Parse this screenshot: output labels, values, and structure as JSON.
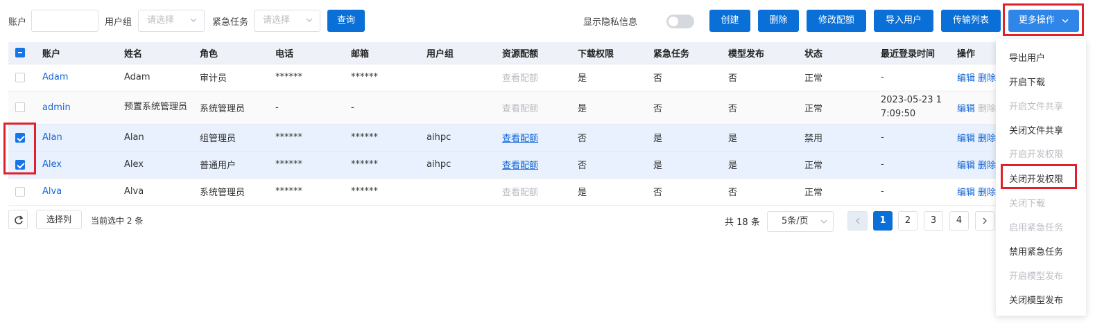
{
  "filters": {
    "account_label": "账户",
    "account_value": "",
    "group_label": "用户组",
    "group_placeholder": "请选择",
    "urgent_label": "紧急任务",
    "urgent_placeholder": "请选择",
    "query_button": "查询"
  },
  "privacy": {
    "label": "显示隐私信息",
    "enabled": false
  },
  "actions": {
    "create": "创建",
    "delete": "删除",
    "edit_quota": "修改配额",
    "import_users": "导入用户",
    "transfer_list": "传输列表",
    "more_actions": "更多操作"
  },
  "table": {
    "headers": [
      "账户",
      "姓名",
      "角色",
      "电话",
      "邮箱",
      "用户组",
      "资源配额",
      "下载权限",
      "紧急任务",
      "模型发布",
      "状态",
      "最近登录时间",
      "操作"
    ],
    "rows": [
      {
        "checked": false,
        "account": "Adam",
        "name": "Adam",
        "role": "审计员",
        "phone": "******",
        "email": "******",
        "group": "",
        "quota": "查看配额",
        "quota_enabled": false,
        "download": "是",
        "urgent": "否",
        "publish": "否",
        "status": "正常",
        "last_login": "-",
        "edit": "编辑",
        "del": "删除"
      },
      {
        "checked": false,
        "account": "admin",
        "name": "预置系统管理员",
        "role": "系统管理员",
        "phone": "-",
        "email": "-",
        "group": "",
        "quota": "查看配额",
        "quota_enabled": false,
        "download": "是",
        "urgent": "否",
        "publish": "否",
        "status": "正常",
        "last_login": "2023-05-23 17:09:50",
        "edit": "编辑",
        "del": "删除"
      },
      {
        "checked": true,
        "account": "Alan",
        "name": "Alan",
        "role": "组管理员",
        "phone": "******",
        "email": "******",
        "group": "aihpc",
        "quota": "查看配额",
        "quota_enabled": true,
        "download": "否",
        "urgent": "是",
        "publish": "是",
        "status": "禁用",
        "last_login": "-",
        "edit": "编辑",
        "del": "删除"
      },
      {
        "checked": true,
        "account": "Alex",
        "name": "Alex",
        "role": "普通用户",
        "phone": "******",
        "email": "******",
        "group": "aihpc",
        "quota": "查看配额",
        "quota_enabled": true,
        "download": "否",
        "urgent": "是",
        "publish": "是",
        "status": "正常",
        "last_login": "-",
        "edit": "编辑",
        "del": "删除"
      },
      {
        "checked": false,
        "account": "Alva",
        "name": "Alva",
        "role": "系统管理员",
        "phone": "******",
        "email": "******",
        "group": "",
        "quota": "查看配额",
        "quota_enabled": false,
        "download": "是",
        "urgent": "否",
        "publish": "否",
        "status": "正常",
        "last_login": "-",
        "edit": "编辑",
        "del": "删除"
      }
    ]
  },
  "footer": {
    "select_columns": "选择列",
    "selected_text": "当前选中 2 条",
    "total_text": "共 18 条",
    "page_size": "5条/页",
    "pages": [
      "1",
      "2",
      "3",
      "4"
    ],
    "current_page": "1"
  },
  "more_menu": {
    "items": [
      {
        "label": "导出用户",
        "enabled": true
      },
      {
        "label": "开启下载",
        "enabled": true
      },
      {
        "label": "开启文件共享",
        "enabled": false
      },
      {
        "label": "关闭文件共享",
        "enabled": true
      },
      {
        "label": "开启开发权限",
        "enabled": false
      },
      {
        "label": "关闭开发权限",
        "enabled": true
      },
      {
        "label": "关闭下载",
        "enabled": false
      },
      {
        "label": "启用紧急任务",
        "enabled": false
      },
      {
        "label": "禁用紧急任务",
        "enabled": true
      },
      {
        "label": "开启模型发布",
        "enabled": false
      },
      {
        "label": "关闭模型发布",
        "enabled": true
      }
    ]
  },
  "colors": {
    "primary": "#0a6fd6",
    "highlight": "#e0202a",
    "selected_row": "#e8f1fd",
    "link": "#1566d6"
  }
}
